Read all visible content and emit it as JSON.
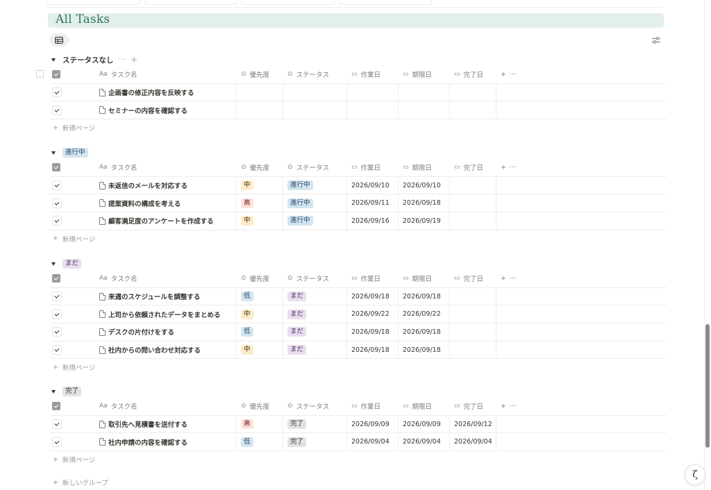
{
  "database": {
    "title": "All Tasks"
  },
  "columns": {
    "name": "タスク名",
    "priority": "優先度",
    "status": "ステータス",
    "work_date": "作業日",
    "due_date": "期限日",
    "done_date": "完了日",
    "name_prefix": "Aa"
  },
  "actions": {
    "new_page": "新規ページ",
    "new_group": "新しいグループ"
  },
  "colors": {
    "title_bg": "#e3efea",
    "title_text": "#2f7a5e",
    "chip_blue": "#d3e5ef",
    "chip_purple": "#e8deee",
    "chip_gray": "#e3e2e0",
    "chip_yellow": "#fdecc8",
    "chip_red": "#ffe2dd"
  },
  "groups": [
    {
      "label": "ステータスなし",
      "rows": [
        {
          "name": "企画書の修正内容を反映する",
          "priority": "",
          "status": "",
          "work": "",
          "due": "",
          "done": ""
        },
        {
          "name": "セミナーの内容を確認する",
          "priority": "",
          "status": "",
          "work": "",
          "due": "",
          "done": ""
        }
      ]
    },
    {
      "label": "進行中",
      "rows": [
        {
          "name": "未返信のメールを対応する",
          "priority": "中",
          "status": "進行中",
          "work": "2026/09/10",
          "due": "2026/09/10",
          "done": ""
        },
        {
          "name": "提案資料の構成を考える",
          "priority": "高",
          "status": "進行中",
          "work": "2026/09/11",
          "due": "2026/09/18",
          "done": ""
        },
        {
          "name": "顧客満足度のアンケートを作成する",
          "priority": "中",
          "status": "進行中",
          "work": "2026/09/16",
          "due": "2026/09/19",
          "done": ""
        }
      ]
    },
    {
      "label": "まだ",
      "rows": [
        {
          "name": "来週のスケジュールを調整する",
          "priority": "低",
          "status": "まだ",
          "work": "2026/09/18",
          "due": "2026/09/18",
          "done": ""
        },
        {
          "name": "上司から依頼されたデータをまとめる",
          "priority": "中",
          "status": "まだ",
          "work": "2026/09/22",
          "due": "2026/09/22",
          "done": ""
        },
        {
          "name": "デスクの片付けをする",
          "priority": "低",
          "status": "まだ",
          "work": "2026/09/18",
          "due": "2026/09/18",
          "done": ""
        },
        {
          "name": "社内からの問い合わせ対応する",
          "priority": "中",
          "status": "まだ",
          "work": "2026/09/18",
          "due": "2026/09/18",
          "done": ""
        }
      ]
    },
    {
      "label": "完了",
      "rows": [
        {
          "name": "取引先へ見積書を送付する",
          "priority": "高",
          "status": "完了",
          "work": "2026/09/09",
          "due": "2026/09/09",
          "done": "2026/09/12"
        },
        {
          "name": "社内申請の内容を確認する",
          "priority": "低",
          "status": "完了",
          "work": "2026/09/04",
          "due": "2026/09/04",
          "done": "2026/09/04"
        }
      ]
    }
  ]
}
